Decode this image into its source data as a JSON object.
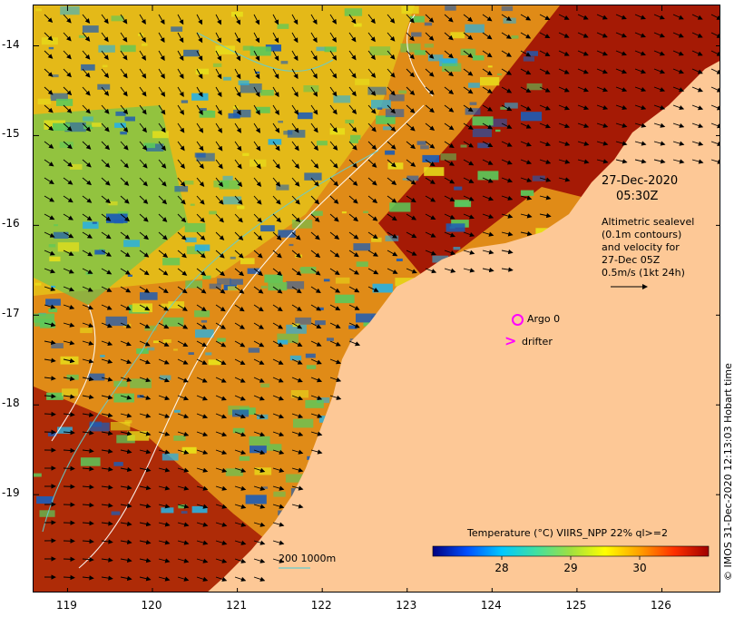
{
  "map": {
    "y_ticks": [
      {
        "value": -14,
        "label": "-14"
      },
      {
        "value": -15,
        "label": "-15"
      },
      {
        "value": -16,
        "label": "-16"
      },
      {
        "value": -17,
        "label": "-17"
      },
      {
        "value": -18,
        "label": "-18"
      },
      {
        "value": -19,
        "label": "-19"
      }
    ],
    "x_ticks": [
      {
        "value": 119,
        "label": "119"
      },
      {
        "value": 120,
        "label": "120"
      },
      {
        "value": 121,
        "label": "121"
      },
      {
        "value": 122,
        "label": "122"
      },
      {
        "value": 123,
        "label": "123"
      },
      {
        "value": 124,
        "label": "124"
      },
      {
        "value": 125,
        "label": "125"
      },
      {
        "value": 126,
        "label": "126"
      }
    ],
    "lon_range": [
      118.6,
      126.7
    ],
    "lat_range": [
      -20.1,
      -13.55
    ],
    "colors": {
      "land": "#fdc896",
      "ocean_base": "#e08b17",
      "warm": "#a51a05",
      "cool": "#1c5cb6",
      "mid": "#5bc95a",
      "yellow": "#e8e01a"
    }
  },
  "header": {
    "date": "27-Dec-2020",
    "time": "05:30Z"
  },
  "legend_notes": {
    "line1": "Altimetric sealevel",
    "line2": "(0.1m contours)",
    "line3": "and velocity for",
    "line4": "27-Dec 05Z",
    "line5": "0.5m/s (1kt 24h)"
  },
  "markers": {
    "argo_label": "Argo 0",
    "drifter_label": "drifter",
    "argo_color": "#ff00ff"
  },
  "scale_bar": {
    "label": "200  1000m"
  },
  "colorbar": {
    "title": "Temperature (°C) VIIRS_NPP 22% ql>=2",
    "ticks": [
      {
        "value": 28,
        "label": "28"
      },
      {
        "value": 29,
        "label": "29"
      },
      {
        "value": 30,
        "label": "30"
      }
    ],
    "range": [
      27.0,
      31.0
    ],
    "stops": [
      "#000080",
      "#0050ff",
      "#00c8ff",
      "#40e0a0",
      "#a0e040",
      "#ffff00",
      "#ffa000",
      "#ff3000",
      "#a00000"
    ]
  },
  "copyright": "© IMOS 31-Dec-2020 12:13:03 Hobart time"
}
